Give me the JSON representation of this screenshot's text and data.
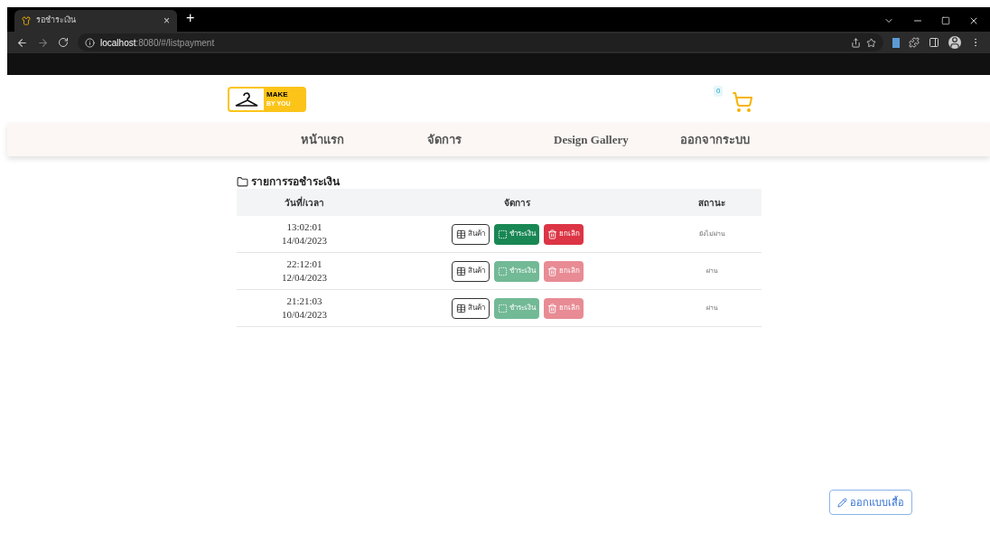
{
  "browser": {
    "tab_title": "รอชำระเงิน",
    "tab_close": "×",
    "new_tab": "+",
    "url_host": "localhost",
    "url_rest": ":8080/#/listpayment"
  },
  "header": {
    "logo_top": "MAKE",
    "logo_bottom": "BY YOU",
    "cart_count": "0"
  },
  "nav": [
    "หน้าแรก",
    "จัดการ",
    "Design Gallery",
    "ออกจากระบบ"
  ],
  "page_title": "รายการรอชำระเงิน",
  "table": {
    "columns": [
      "วันที่/เวลา",
      "จัดการ",
      "สถานะ"
    ],
    "rows": [
      {
        "time": "13:02:01",
        "date": "14/04/2023",
        "actions": [
          "สินค้า",
          "ชำระเงิน",
          "ยกเลิก"
        ],
        "disabled": false,
        "status": "ยังไม่ผ่าน"
      },
      {
        "time": "22:12:01",
        "date": "12/04/2023",
        "actions": [
          "สินค้า",
          "ชำระเงิน",
          "ยกเลิก"
        ],
        "disabled": true,
        "status": "ผ่าน"
      },
      {
        "time": "21:21:03",
        "date": "10/04/2023",
        "actions": [
          "สินค้า",
          "ชำระเงิน",
          "ยกเลิก"
        ],
        "disabled": true,
        "status": "ผ่าน"
      }
    ]
  },
  "design_button": "ออกแบบเสื้อ"
}
